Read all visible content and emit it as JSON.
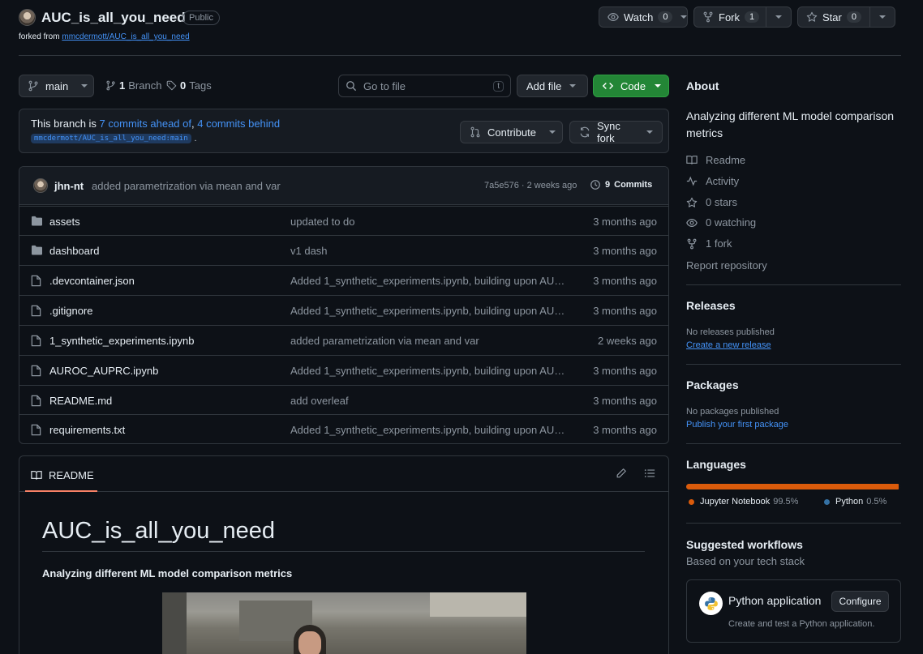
{
  "repo": {
    "name": "AUC_is_all_you_need",
    "visibility": "Public",
    "forked_prefix": "forked from",
    "forked_from": "mmcdermott/AUC_is_all_you_need"
  },
  "actions": {
    "watch_label": "Watch",
    "watch_count": "0",
    "fork_label": "Fork",
    "fork_count": "1",
    "star_label": "Star",
    "star_count": "0"
  },
  "toolbar": {
    "branch": "main",
    "branch_count": "1",
    "branch_label": "Branch",
    "tag_count": "0",
    "tag_label": "Tags",
    "go_to_file_placeholder": "Go to file",
    "go_to_file_key": "t",
    "add_file": "Add file",
    "code": "Code"
  },
  "banner": {
    "text_prefix": "This branch is",
    "ahead": "7 commits ahead of",
    "comma": ",",
    "behind": "4 commits behind",
    "upstream": "mmcdermott/AUC_is_all_you_need:main",
    "period": ".",
    "contribute": "Contribute",
    "sync_fork": "Sync fork"
  },
  "latest_commit": {
    "author": "jhn-nt",
    "message": "added parametrization via mean and var",
    "sha_time": "7a5e576 · 2 weeks ago",
    "commits_count": "9",
    "commits_label": "Commits"
  },
  "files": [
    {
      "type": "dir",
      "name": "assets",
      "message": "updated to do",
      "date": "3 months ago"
    },
    {
      "type": "dir",
      "name": "dashboard",
      "message": "v1 dash",
      "date": "3 months ago"
    },
    {
      "type": "file",
      "name": ".devcontainer.json",
      "message": "Added 1_synthetic_experiments.ipynb, building upon AUR...",
      "date": "3 months ago"
    },
    {
      "type": "file",
      "name": ".gitignore",
      "message": "Added 1_synthetic_experiments.ipynb, building upon AUR...",
      "date": "3 months ago"
    },
    {
      "type": "file",
      "name": "1_synthetic_experiments.ipynb",
      "message": "added parametrization via mean and var",
      "date": "2 weeks ago"
    },
    {
      "type": "file",
      "name": "AUROC_AUPRC.ipynb",
      "message": "Added 1_synthetic_experiments.ipynb, building upon AUR...",
      "date": "3 months ago"
    },
    {
      "type": "file",
      "name": "README.md",
      "message": "add overleaf",
      "date": "3 months ago"
    },
    {
      "type": "file",
      "name": "requirements.txt",
      "message": "Added 1_synthetic_experiments.ipynb, building upon AUR...",
      "date": "3 months ago"
    }
  ],
  "readme": {
    "tab_label": "README",
    "title": "AUC_is_all_you_need",
    "subtitle": "Analyzing different ML model comparison metrics"
  },
  "about": {
    "heading": "About",
    "description": "Analyzing different ML model comparison metrics",
    "readme": "Readme",
    "activity": "Activity",
    "stars": "0 stars",
    "watching": "0 watching",
    "forks": "1 fork",
    "report": "Report repository"
  },
  "releases": {
    "heading": "Releases",
    "none": "No releases published",
    "create": "Create a new release"
  },
  "packages": {
    "heading": "Packages",
    "none": "No packages published",
    "publish": "Publish your first package"
  },
  "languages": {
    "heading": "Languages",
    "items": [
      {
        "name": "Jupyter Notebook",
        "percent": "99.5%",
        "share": 99.5,
        "color": "#da5b0b"
      },
      {
        "name": "Python",
        "percent": "0.5%",
        "share": 0.5,
        "color": "#3572a5"
      }
    ]
  },
  "workflows": {
    "heading": "Suggested workflows",
    "subheading": "Based on your tech stack",
    "card_title": "Python application",
    "card_desc": "Create and test a Python application.",
    "configure": "Configure"
  },
  "colors": {
    "accent_link": "#4493f8",
    "code_button": "#238636",
    "background": "#0d1117"
  }
}
